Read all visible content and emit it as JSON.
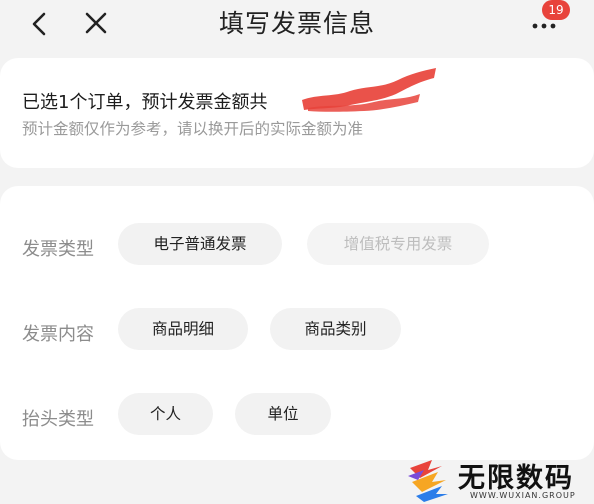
{
  "header": {
    "title": "填写发票信息",
    "badge_count": "19",
    "back_icon": "chevron-left-icon",
    "close_icon": "close-icon",
    "more_icon": "more-dots-icon"
  },
  "summary": {
    "main_text": "已选1个订单，预计发票金额共",
    "hint_text": "预计金额仅作为参考，请以换开后的实际金额为准"
  },
  "form": {
    "invoice_type": {
      "label": "发票类型",
      "options": [
        "电子普通发票",
        "增值税专用发票"
      ]
    },
    "invoice_content": {
      "label": "发票内容",
      "options": [
        "商品明细",
        "商品类别"
      ]
    },
    "title_type": {
      "label": "抬头类型",
      "options": [
        "个人",
        "单位"
      ]
    }
  },
  "watermark": {
    "name": "无限数码",
    "url": "WWW.WUXIAN.GROUP"
  },
  "colors": {
    "badge": "#e8433b",
    "redaction": "#e8433b",
    "chip_bg": "#f2f2f2",
    "label": "#8c8c8c"
  }
}
